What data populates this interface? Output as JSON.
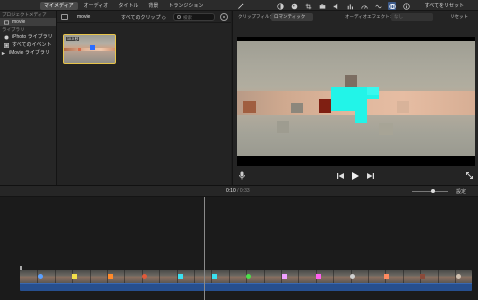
{
  "top_bar": {
    "tabs": [
      {
        "label": "マイメディア",
        "active": true
      },
      {
        "label": "オーディオ",
        "active": false
      },
      {
        "label": "タイトル",
        "active": false
      },
      {
        "label": "背景",
        "active": false
      },
      {
        "label": "トランジション",
        "active": false
      }
    ],
    "tools": [
      "magic-wand-icon",
      "color-balance-icon",
      "color-palette-icon",
      "crop-icon",
      "camera-icon",
      "volume-icon",
      "equalizer-icon",
      "speed-icon",
      "noise-reduction-icon",
      "clip-filter-icon",
      "info-icon"
    ],
    "reset_all_label": "すべてをリセット"
  },
  "sidebar": {
    "project_media_heading": "プロジェクトメディア",
    "project_item": "movie",
    "libraries_heading": "ライブラリ",
    "items": [
      {
        "label": "iPhoto ライブラリ",
        "icon": "photos-icon"
      },
      {
        "label": "すべてのイベント",
        "icon": "events-icon"
      },
      {
        "label": "iMovie ライブラリ",
        "icon": "library-icon"
      }
    ]
  },
  "browser": {
    "title": "movie",
    "filter_label": "すべてのクリップ ◇",
    "search_placeholder": "検索",
    "clip": {
      "duration": "10.0 秒"
    }
  },
  "viewer": {
    "clip_filter_label": "クリップフィルタ:",
    "clip_filter_value": "ロマンティック",
    "audio_effect_label": "オーディオエフェクト:",
    "audio_effect_value": "なし",
    "reset_label": "リセット"
  },
  "timeline": {
    "current_time": "0:10",
    "separator": " / ",
    "total_time": "0:33",
    "settings_label": "設定",
    "zoom_level": 0.55,
    "playhead_fraction": 0.41
  },
  "colors": {
    "accent": "#3c5a8a",
    "selection": "#e8c44a",
    "audio_track": "#264f8f",
    "cyan_block": "#22f4e8",
    "thumb_blue": "#2a6cff"
  }
}
